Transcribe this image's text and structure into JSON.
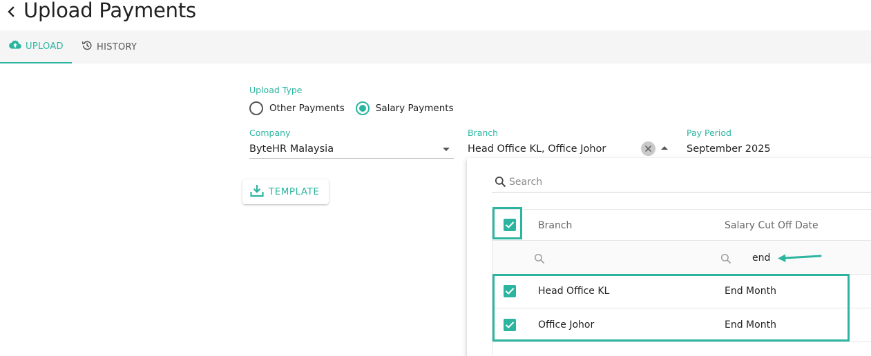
{
  "header": {
    "title": "Upload Payments"
  },
  "tabs": [
    {
      "label": "UPLOAD"
    },
    {
      "label": "HISTORY"
    }
  ],
  "form": {
    "upload_type": {
      "label": "Upload Type",
      "options": [
        "Other Payments",
        "Salary Payments"
      ],
      "selected": "Salary Payments"
    },
    "company": {
      "label": "Company",
      "value": "ByteHR Malaysia"
    },
    "branch": {
      "label": "Branch",
      "value": "Head Office KL, Office Johor"
    },
    "pay_period": {
      "label": "Pay Period",
      "value": "September 2025"
    },
    "template_button": "TEMPLATE"
  },
  "branch_dropdown": {
    "search_placeholder": "Search",
    "columns": [
      "Branch",
      "Salary Cut Off Date"
    ],
    "filters": {
      "branch": "",
      "salary_cut_off_date": "end"
    },
    "rows": [
      {
        "branch": "Head Office KL",
        "salary_cut_off_date": "End Month",
        "checked": true
      },
      {
        "branch": "Office Johor",
        "salary_cut_off_date": "End Month",
        "checked": true
      }
    ],
    "select_all_checked": true
  },
  "colors": {
    "accent": "#2bb5a0",
    "annotation": "#2bb5a0"
  },
  "icons": {
    "back": "chevron-left-icon",
    "upload_tab": "cloud-upload-icon",
    "history_tab": "history-icon",
    "template": "download-icon",
    "search": "search-icon",
    "clear": "close-icon"
  }
}
